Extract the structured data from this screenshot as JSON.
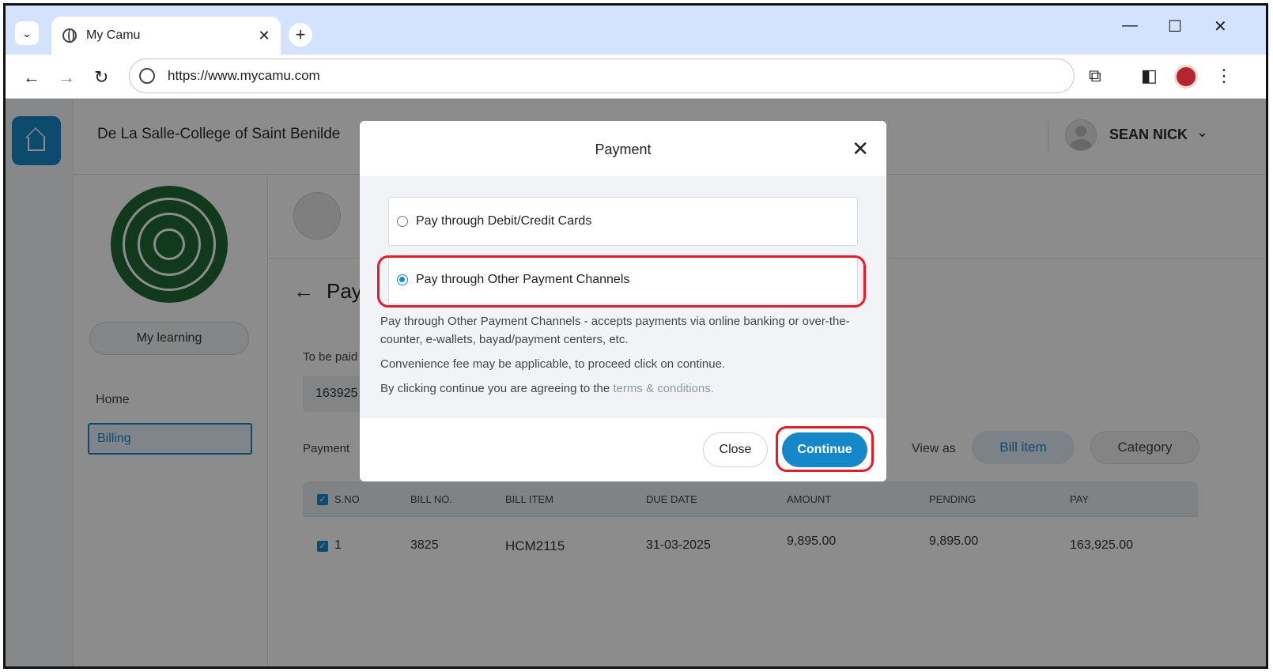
{
  "browser": {
    "tab_title": "My Camu",
    "url": "https://www.mycamu.com",
    "tab_menu_icon": "chevron-down-icon",
    "new_tab_label": "+",
    "close_tab_label": "✕"
  },
  "header": {
    "college_name": "De La Salle-College of Saint Benilde",
    "user_name": "SEAN NICK"
  },
  "sidebar": {
    "learning_button": "My learning",
    "items": [
      {
        "label": "Home"
      },
      {
        "label": "Billing"
      }
    ]
  },
  "main": {
    "page_title": "Pay",
    "to_be_paid_label": "To be paid",
    "amount_value": "163925",
    "payment_label": "Payment",
    "view_as_label": "View as",
    "view_options": [
      "Bill item",
      "Category"
    ],
    "table": {
      "headers": [
        "S.NO",
        "BILL NO.",
        "BILL ITEM",
        "DUE DATE",
        "AMOUNT",
        "PENDING",
        "PAY"
      ],
      "rows": [
        {
          "sno": "1",
          "bill_no": "3825",
          "bill_item": "HCM2115",
          "due_date": "31-03-2025",
          "amount": "9,895.00",
          "pending": "9,895.00",
          "pay": "163,925.00"
        }
      ]
    }
  },
  "modal": {
    "title": "Payment",
    "options": [
      {
        "label": "Pay through Debit/Credit Cards",
        "selected": false
      },
      {
        "label": "Pay through Other Payment Channels",
        "selected": true
      }
    ],
    "description_1": "Pay through Other Payment Channels - accepts payments via online banking or over-the-counter, e-wallets, bayad/payment centers, etc.",
    "description_2": "Convenience fee may be applicable, to proceed click on continue.",
    "description_3_prefix": "By clicking continue you are agreeing to the",
    "terms_link": "terms & conditions.",
    "close_button": "Close",
    "continue_button": "Continue"
  },
  "colors": {
    "accent": "#1687c9",
    "highlight": "#e01d2a",
    "seal": "#1f6b34"
  }
}
